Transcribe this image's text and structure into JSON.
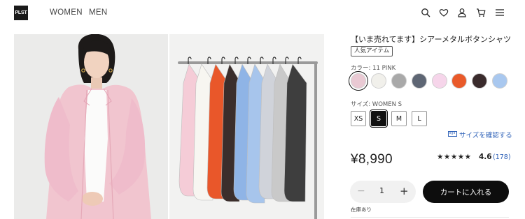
{
  "header": {
    "logo": "PLST",
    "nav": [
      {
        "label": "WOMEN"
      },
      {
        "label": "MEN"
      }
    ],
    "icons": [
      "search-icon",
      "heart-icon",
      "user-icon",
      "cart-icon",
      "menu-icon"
    ]
  },
  "gallery": {
    "images": [
      "model-photo",
      "shirt-rack-photo"
    ]
  },
  "product": {
    "title": "【いま売れてます】シアーメタルボタンシャツ",
    "badge": "人気アイテム",
    "color_label": "カラー: 11 PINK",
    "colors": [
      {
        "hex": "#e9c9d3",
        "selected": true
      },
      {
        "hex": "#f1f0eb"
      },
      {
        "hex": "#a9a9a9"
      },
      {
        "hex": "#5e6674"
      },
      {
        "hex": "#f6d5ea"
      },
      {
        "hex": "#e95a2a"
      },
      {
        "hex": "#3a2b2c"
      },
      {
        "hex": "#a9c8ef"
      }
    ],
    "size_label": "サイズ: WOMEN S",
    "sizes": [
      {
        "label": "XS"
      },
      {
        "label": "S",
        "selected": true
      },
      {
        "label": "M"
      },
      {
        "label": "L"
      }
    ],
    "size_guide": "サイズを確認する",
    "price": "¥8,990",
    "stars": "★★★★★",
    "rating": "4.6",
    "review_count": "(178)",
    "quantity": "1",
    "minus": "−",
    "plus": "+",
    "cart_button": "カートに入れる",
    "stock": "在庫あり"
  },
  "colors": {
    "accent_link": "#2f62b8",
    "cart_button_bg": "#0d0d0d"
  }
}
